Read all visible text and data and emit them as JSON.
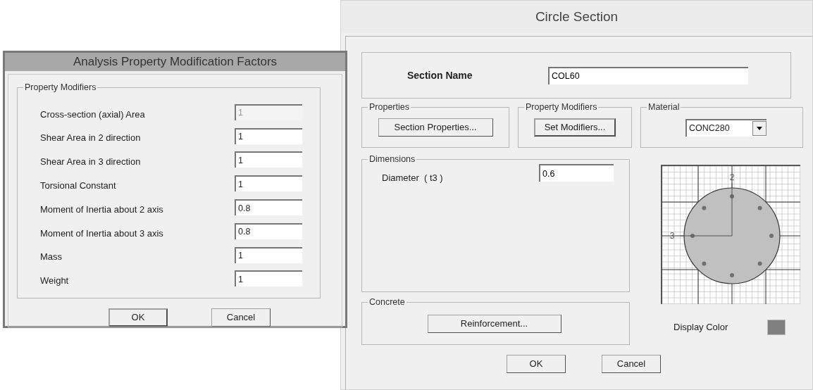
{
  "modifiers_dialog": {
    "title": "Analysis Property Modification Factors",
    "group_label": "Property Modifiers",
    "rows": [
      {
        "label": "Cross-section (axial) Area",
        "value": "1",
        "disabled": true
      },
      {
        "label": "Shear Area in 2 direction",
        "value": "1",
        "disabled": false
      },
      {
        "label": "Shear Area in 3 direction",
        "value": "1",
        "disabled": false
      },
      {
        "label": "Torsional Constant",
        "value": "1",
        "disabled": false
      },
      {
        "label": "Moment of Inertia about 2 axis",
        "value": "0.8",
        "disabled": false
      },
      {
        "label": "Moment of Inertia about 3 axis",
        "value": "0.8",
        "disabled": false
      },
      {
        "label": "Mass",
        "value": "1",
        "disabled": false
      },
      {
        "label": "Weight",
        "value": "1",
        "disabled": false
      }
    ],
    "buttons": [
      "OK",
      "Cancel"
    ]
  },
  "section_dialog": {
    "title": "Circle Section",
    "section_name_label": "Section Name",
    "section_name": "COL60",
    "properties": {
      "group_label": "Properties",
      "button": "Section Properties..."
    },
    "property_modifiers": {
      "group_label": "Property Modifiers",
      "button": "Set Modifiers..."
    },
    "material": {
      "group_label": "Material",
      "value": "CONC280"
    },
    "dimensions": {
      "group_label": "Dimensions",
      "label": "Diameter  ( t3 )",
      "value": "0.6"
    },
    "section_drawing": {
      "axis_labels": [
        "2",
        "3"
      ]
    },
    "concrete": {
      "group_label": "Concrete",
      "button": "Reinforcement..."
    },
    "display_color": {
      "label": "Display Color",
      "color": "#808080"
    },
    "buttons": [
      "OK",
      "Cancel"
    ]
  }
}
